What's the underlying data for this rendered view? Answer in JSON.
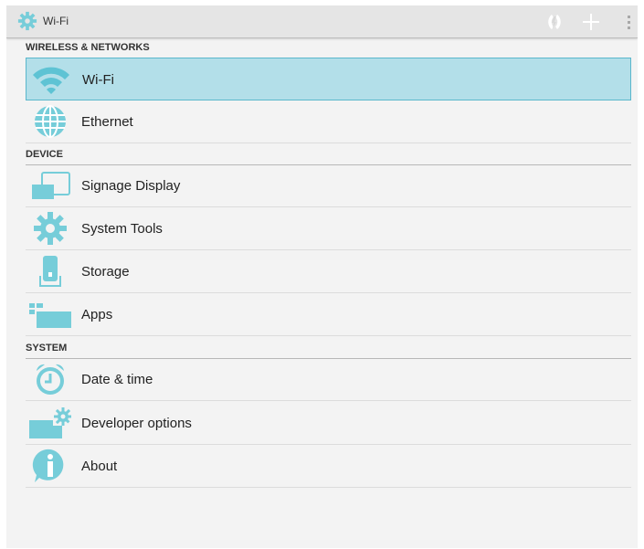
{
  "colors": {
    "accent": "#76cdd9",
    "selected_bg": "#b3dfe9",
    "selected_border": "#5ab7cc"
  },
  "actionbar": {
    "title": "Wi-Fi",
    "icon": "gear-icon",
    "actions": [
      "wps-icon",
      "add-icon",
      "overflow-menu-icon"
    ]
  },
  "sections": [
    {
      "title": "WIRELESS & NETWORKS",
      "items": [
        {
          "label": "Wi-Fi",
          "icon": "wifi-icon",
          "selected": true
        },
        {
          "label": "Ethernet",
          "icon": "globe-icon"
        }
      ]
    },
    {
      "title": "DEVICE",
      "items": [
        {
          "label": "Signage Display",
          "icon": "display-icon"
        },
        {
          "label": "System Tools",
          "icon": "gear-icon"
        },
        {
          "label": "Storage",
          "icon": "storage-icon"
        },
        {
          "label": "Apps",
          "icon": "apps-icon"
        }
      ]
    },
    {
      "title": "SYSTEM",
      "items": [
        {
          "label": "Date & time",
          "icon": "alarm-clock-icon"
        },
        {
          "label": "Developer options",
          "icon": "developer-gear-icon"
        },
        {
          "label": "About",
          "icon": "info-icon"
        }
      ]
    }
  ]
}
